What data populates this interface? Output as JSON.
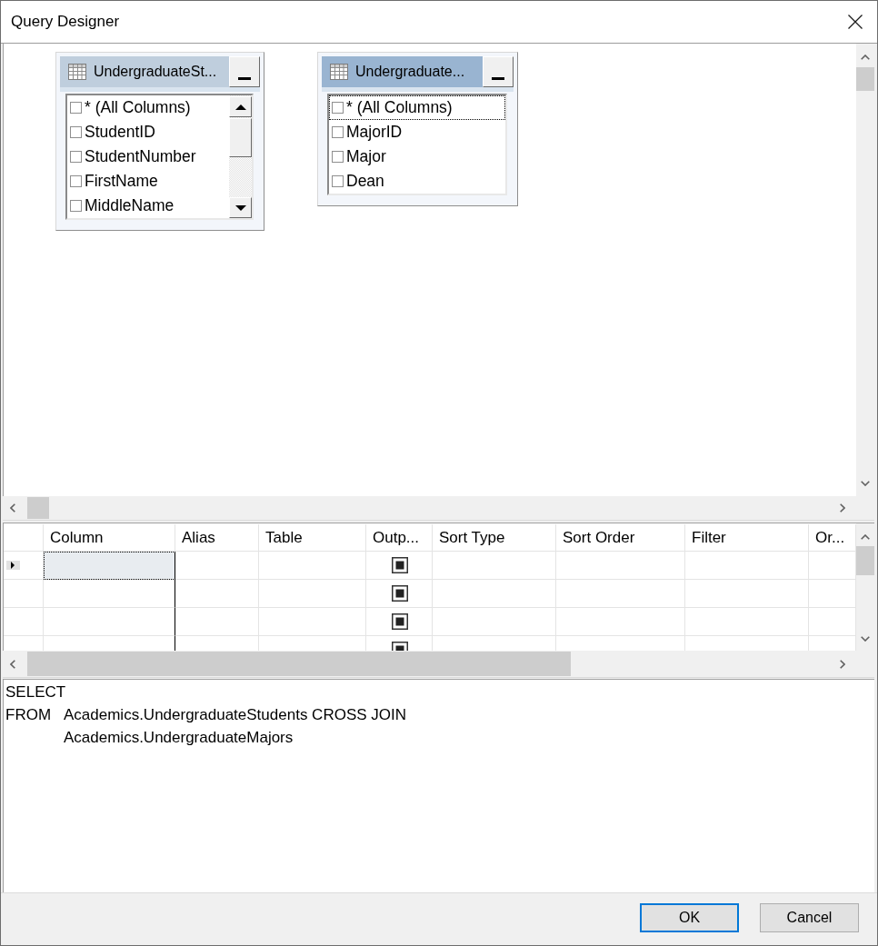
{
  "window": {
    "title": "Query Designer"
  },
  "diagram": {
    "tables": [
      {
        "title": "UndergraduateSt...",
        "selected": false,
        "scrollbar": true,
        "columns": [
          {
            "name": "* (All Columns)",
            "checked": false,
            "focused": false
          },
          {
            "name": "StudentID",
            "checked": false,
            "focused": false
          },
          {
            "name": "StudentNumber",
            "checked": false,
            "focused": false
          },
          {
            "name": "FirstName",
            "checked": false,
            "focused": false
          },
          {
            "name": "MiddleName",
            "checked": false,
            "focused": false
          }
        ]
      },
      {
        "title": "Undergraduate...",
        "selected": true,
        "scrollbar": false,
        "columns": [
          {
            "name": "* (All Columns)",
            "checked": false,
            "focused": true
          },
          {
            "name": "MajorID",
            "checked": false,
            "focused": false
          },
          {
            "name": "Major",
            "checked": false,
            "focused": false
          },
          {
            "name": "Dean",
            "checked": false,
            "focused": false
          }
        ]
      }
    ]
  },
  "grid": {
    "columns": [
      {
        "label": "Column",
        "kind": "text"
      },
      {
        "label": "Alias",
        "kind": "text"
      },
      {
        "label": "Table",
        "kind": "text"
      },
      {
        "label": "Outp...",
        "kind": "checkbox"
      },
      {
        "label": "Sort Type",
        "kind": "text"
      },
      {
        "label": "Sort Order",
        "kind": "text"
      },
      {
        "label": "Filter",
        "kind": "text"
      },
      {
        "label": "Or...",
        "kind": "text"
      }
    ],
    "rows": [
      {
        "selected": true,
        "output": true
      },
      {
        "selected": false,
        "output": true
      },
      {
        "selected": false,
        "output": true
      },
      {
        "selected": false,
        "output": true
      }
    ]
  },
  "sql": {
    "clauses": [
      {
        "keyword": "SELECT"
      },
      {
        "keyword": "FROM",
        "lines": [
          "Academics.UndergraduateStudents CROSS JOIN",
          "Academics.UndergraduateMajors"
        ]
      }
    ]
  },
  "buttons": [
    {
      "label": "OK",
      "default": true
    },
    {
      "label": "Cancel",
      "default": false
    }
  ]
}
